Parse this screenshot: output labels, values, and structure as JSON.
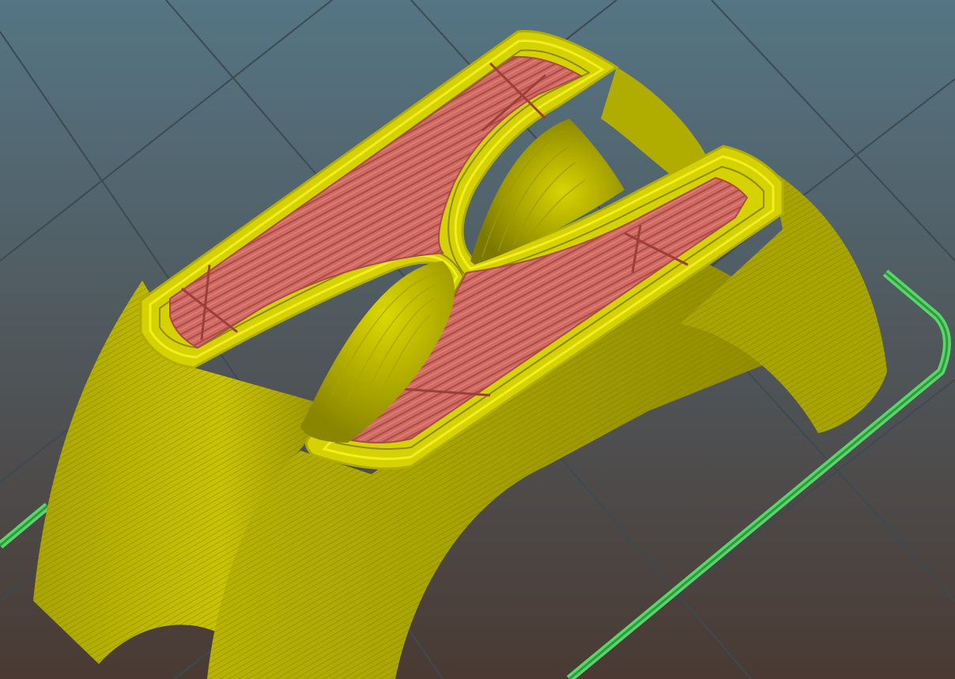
{
  "viewport": {
    "label": "",
    "background_top_color": "#557584",
    "background_bottom_color": "#4a3a33",
    "grid_color": "#3c4a52"
  },
  "model": {
    "perimeter_color": "#c9c400",
    "perimeter_dark_color": "#8f8b00",
    "perimeter_highlight_color": "#f2ee20",
    "infill_color": "#d16a62",
    "infill_line_color": "#9a3f3a"
  },
  "skirt": {
    "color": "#59d66a"
  }
}
